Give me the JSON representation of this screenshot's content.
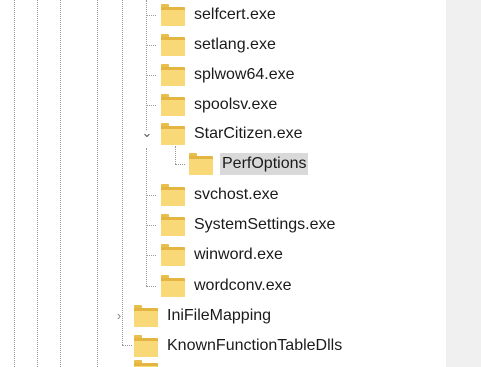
{
  "tree": {
    "items": [
      {
        "label": "selfcert.exe",
        "icon": "folder-icon"
      },
      {
        "label": "setlang.exe",
        "icon": "folder-icon"
      },
      {
        "label": "splwow64.exe",
        "icon": "folder-icon"
      },
      {
        "label": "spoolsv.exe",
        "icon": "folder-icon"
      },
      {
        "label": "StarCitizen.exe",
        "icon": "folder-icon",
        "expanded": true
      },
      {
        "label": "PerfOptions",
        "icon": "folder-icon",
        "selected": true
      },
      {
        "label": "svchost.exe",
        "icon": "folder-icon"
      },
      {
        "label": "SystemSettings.exe",
        "icon": "folder-icon"
      },
      {
        "label": "winword.exe",
        "icon": "folder-icon"
      },
      {
        "label": "wordconv.exe",
        "icon": "folder-icon"
      },
      {
        "label": "IniFileMapping",
        "icon": "folder-icon",
        "expanded": false
      },
      {
        "label": "KnownFunctionTableDlls",
        "icon": "folder-icon"
      }
    ],
    "colors": {
      "selection": "#d9d9d9",
      "folder_front": "#f9d977",
      "folder_back": "#e4b540",
      "scrollbar_track": "#f0f0f0"
    }
  }
}
